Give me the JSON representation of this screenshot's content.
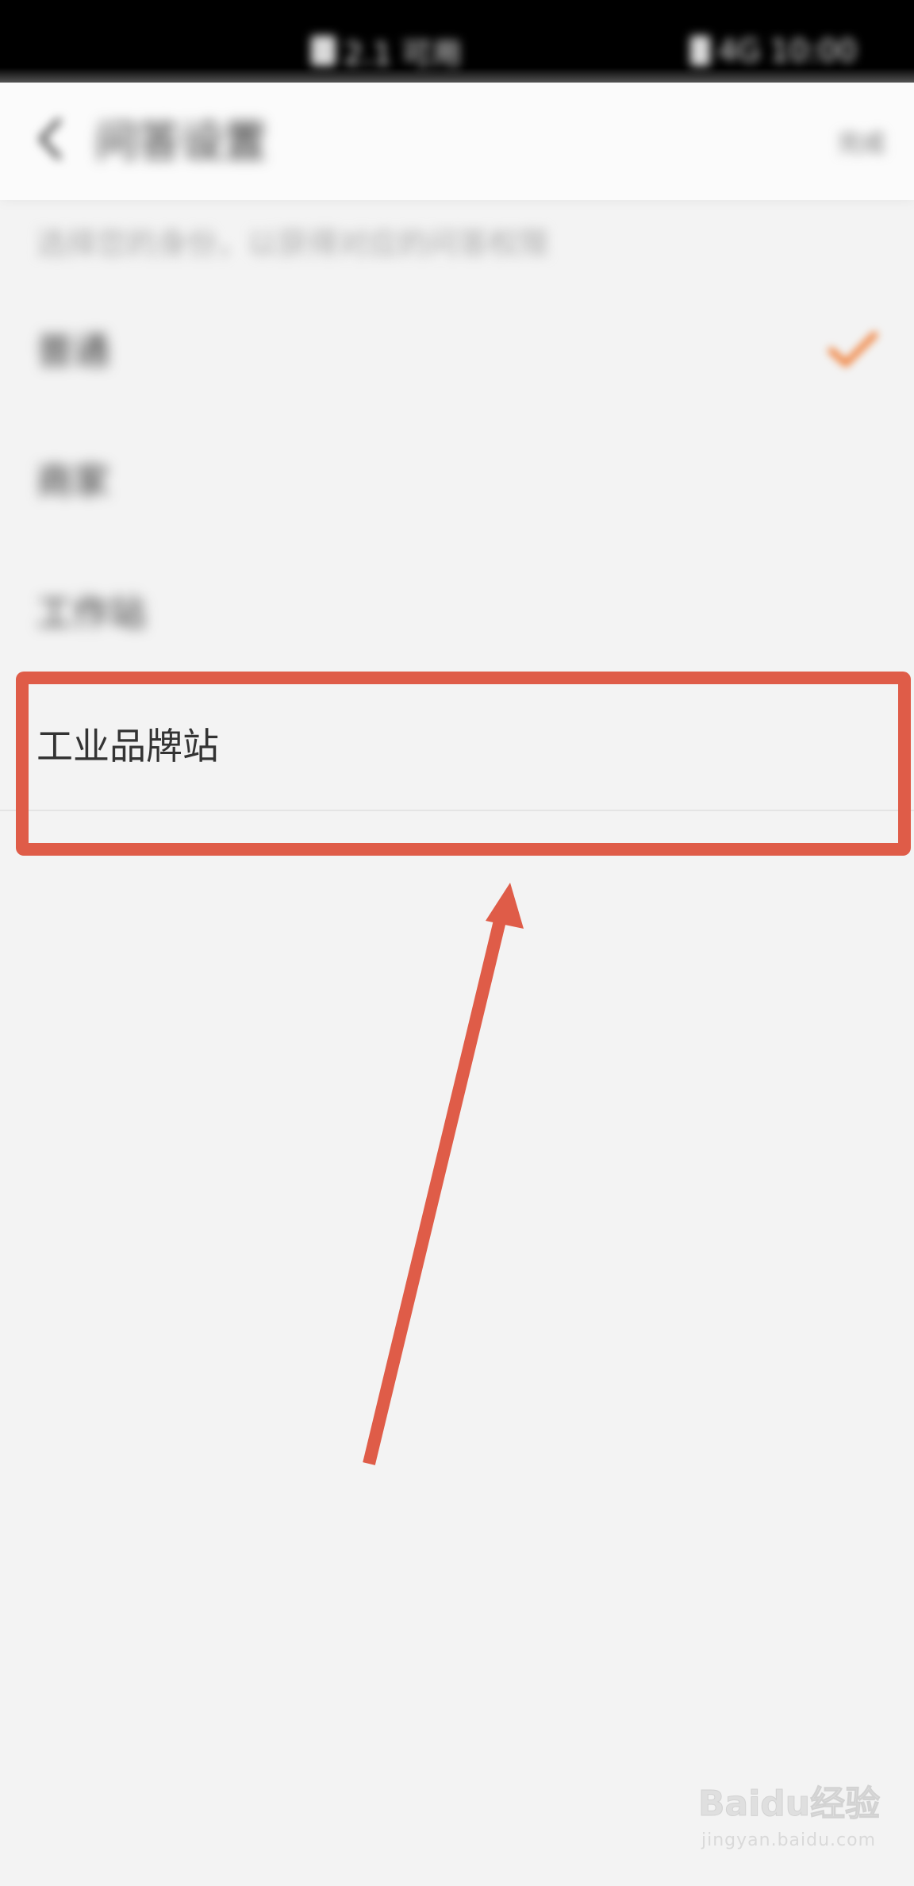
{
  "status_bar": {
    "center_text": "2.1 可用",
    "right_text": "4G 10:00"
  },
  "header": {
    "title": "问答设置",
    "action_label": "完成"
  },
  "hint": "选择您的身份，以获得对应的问答权限",
  "items": [
    {
      "label": "普通",
      "selected": true
    },
    {
      "label": "商家",
      "selected": false
    },
    {
      "label": "工作站",
      "selected": false
    },
    {
      "label": "工业品牌站",
      "selected": false
    }
  ],
  "annotation": {
    "color": "#df5c48",
    "highlighted_item": "工业品牌站"
  },
  "watermark": {
    "logo": "Baidu经验",
    "sub": "jingyan.baidu.com"
  },
  "colors": {
    "accent": "#f08a4b",
    "annotation": "#df5c48",
    "background": "#f3f3f3"
  }
}
